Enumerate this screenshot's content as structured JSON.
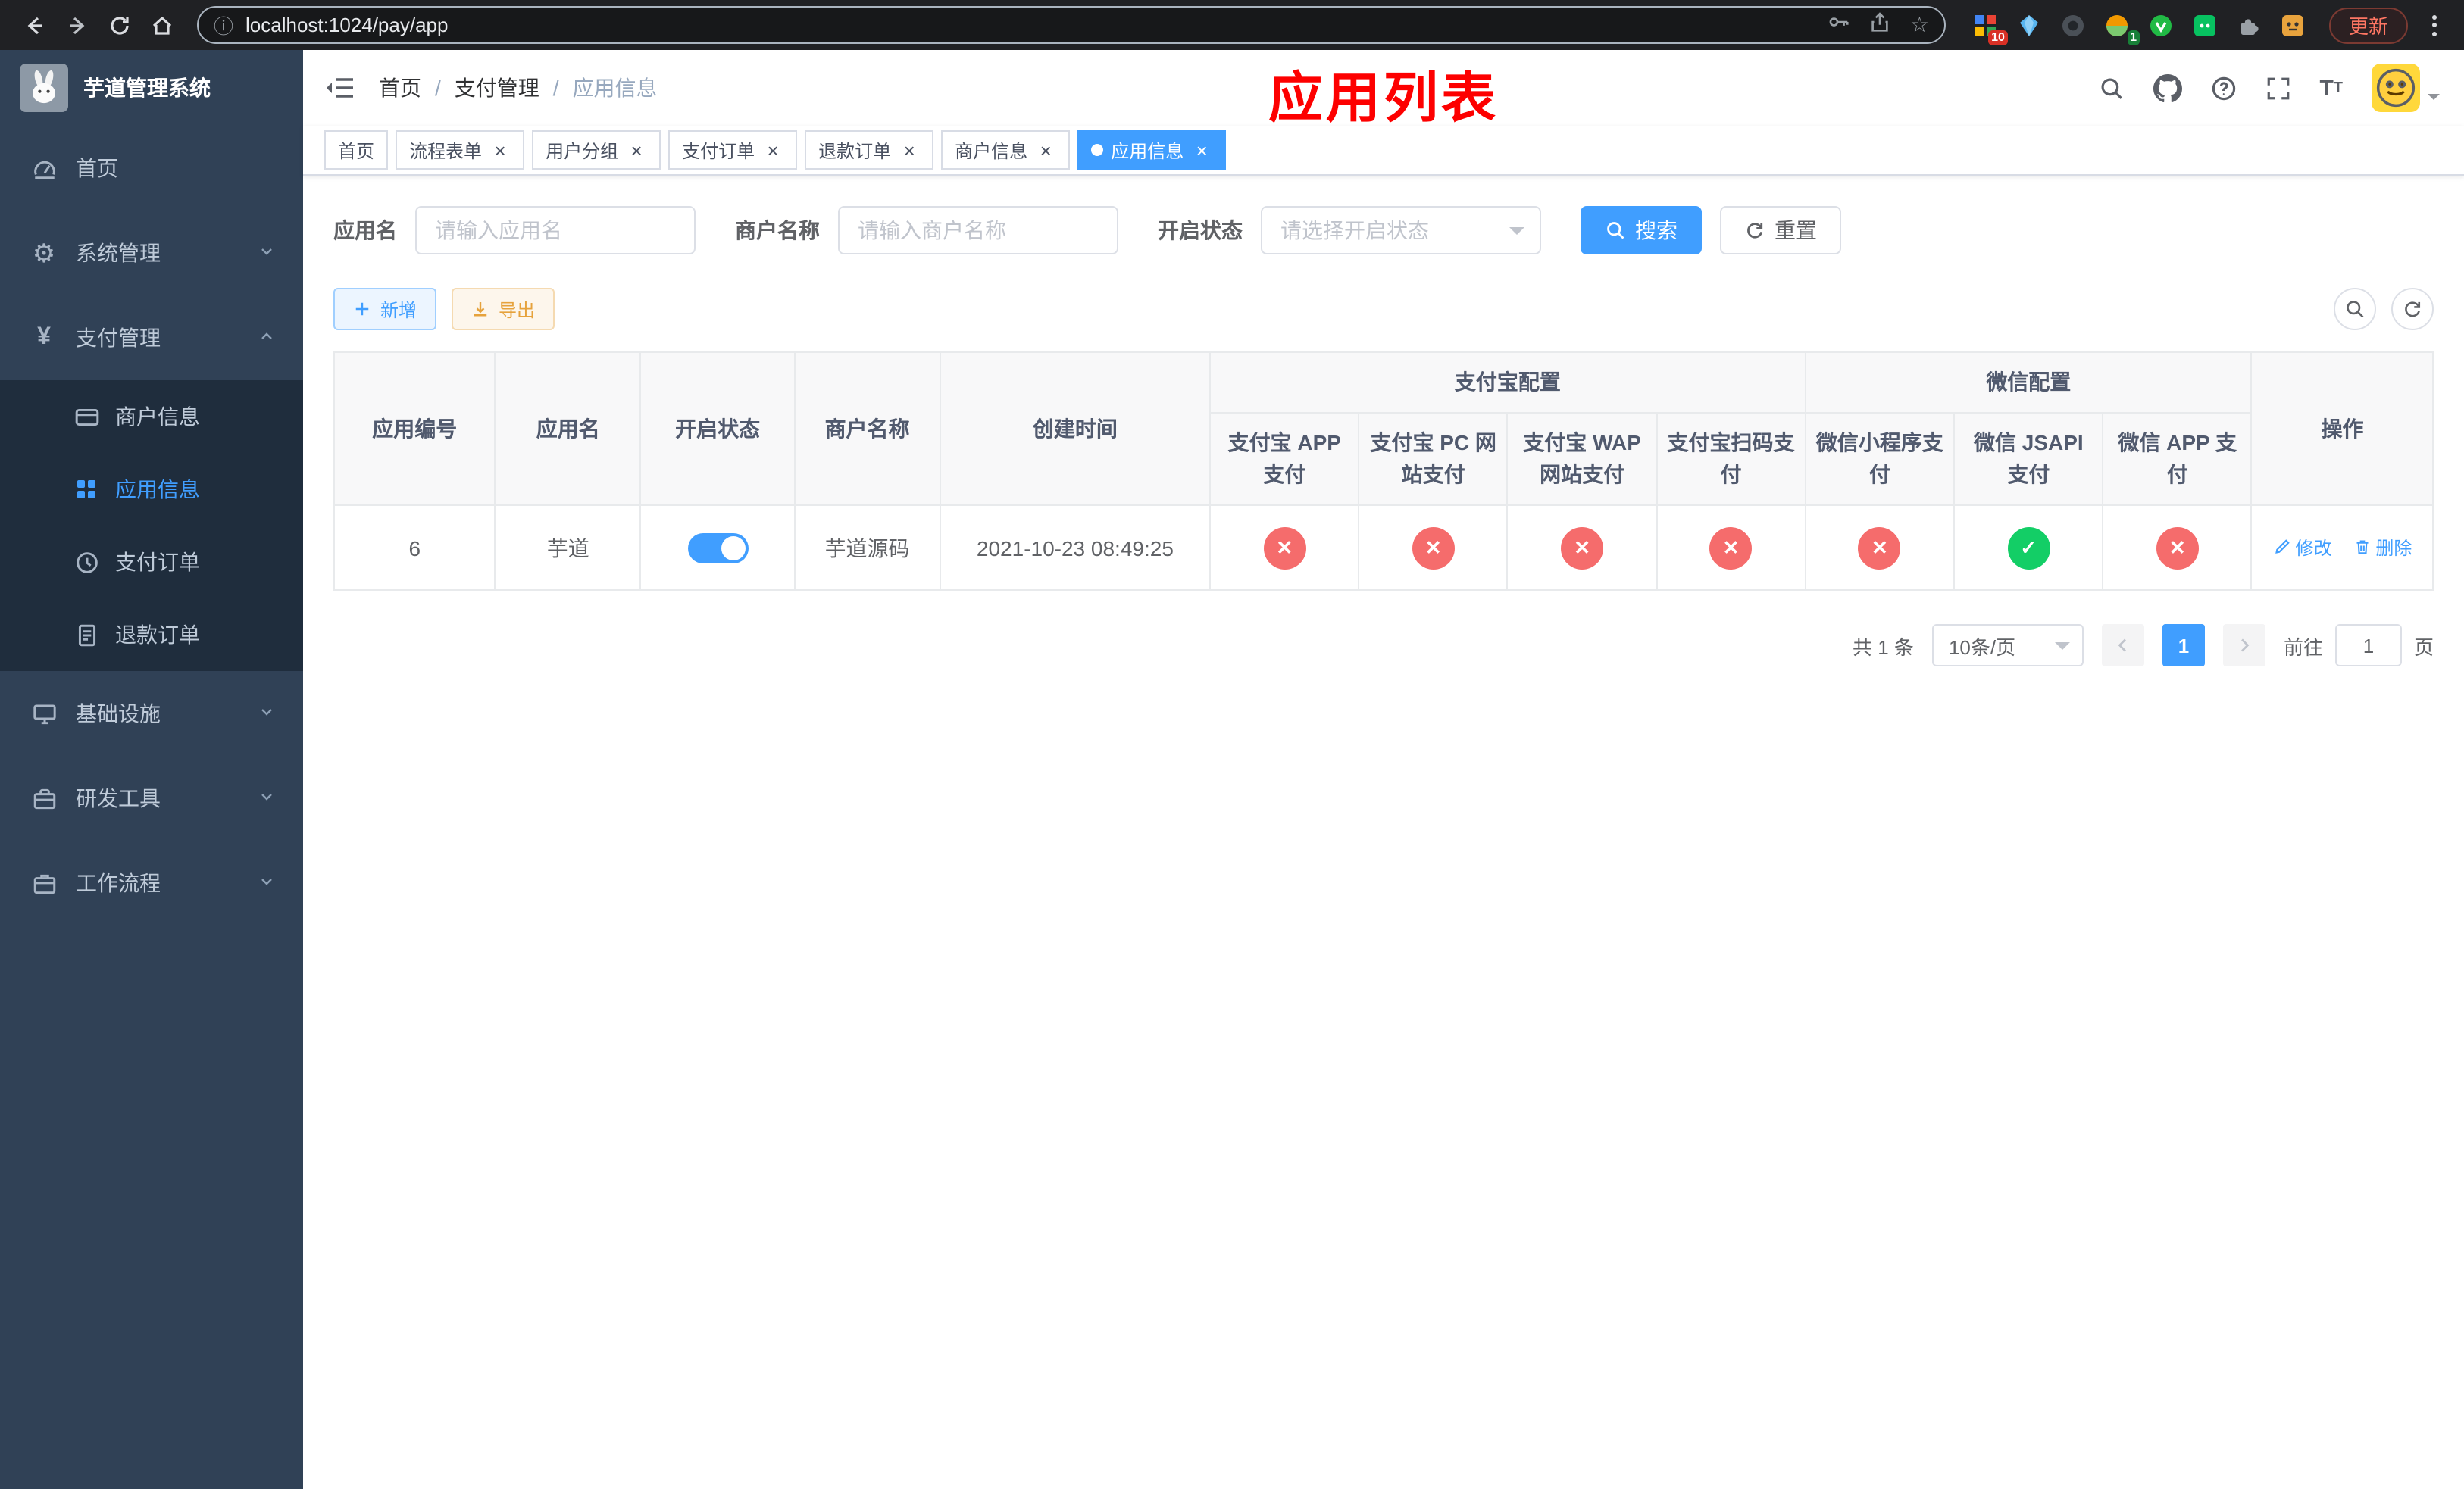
{
  "browser": {
    "url": "localhost:1024/pay/app",
    "update_label": "更新",
    "ext_badge_grid": "10",
    "ext_badge_avatar": "1"
  },
  "annotation": "应用列表",
  "sidebar": {
    "title": "芋道管理系统",
    "items": [
      {
        "label": "首页"
      },
      {
        "label": "系统管理"
      },
      {
        "label": "支付管理",
        "expanded": true,
        "children": [
          {
            "label": "商户信息",
            "active": false
          },
          {
            "label": "应用信息",
            "active": true
          },
          {
            "label": "支付订单",
            "active": false
          },
          {
            "label": "退款订单",
            "active": false
          }
        ]
      },
      {
        "label": "基础设施"
      },
      {
        "label": "研发工具"
      },
      {
        "label": "工作流程"
      }
    ]
  },
  "navbar": {
    "breadcrumb": [
      "首页",
      "支付管理",
      "应用信息"
    ]
  },
  "tabs": [
    {
      "label": "首页",
      "closable": false,
      "active": false
    },
    {
      "label": "流程表单",
      "closable": true,
      "active": false
    },
    {
      "label": "用户分组",
      "closable": true,
      "active": false
    },
    {
      "label": "支付订单",
      "closable": true,
      "active": false
    },
    {
      "label": "退款订单",
      "closable": true,
      "active": false
    },
    {
      "label": "商户信息",
      "closable": true,
      "active": false
    },
    {
      "label": "应用信息",
      "closable": true,
      "active": true
    }
  ],
  "filters": {
    "app_name_label": "应用名",
    "app_name_placeholder": "请输入应用名",
    "merchant_label": "商户名称",
    "merchant_placeholder": "请输入商户名称",
    "status_label": "开启状态",
    "status_placeholder": "请选择开启状态",
    "search_label": "搜索",
    "reset_label": "重置"
  },
  "toolbar": {
    "add_label": "新增",
    "export_label": "导出"
  },
  "table": {
    "group_alipay": "支付宝配置",
    "group_wechat": "微信配置",
    "col_id": "应用编号",
    "col_name": "应用名",
    "col_status": "开启状态",
    "col_merchant": "商户名称",
    "col_created": "创建时间",
    "col_alipay_app": "支付宝 APP 支付",
    "col_alipay_pc": "支付宝 PC 网站支付",
    "col_alipay_wap": "支付宝 WAP 网站支付",
    "col_alipay_qr": "支付宝扫码支付",
    "col_wx_lite": "微信小程序支付",
    "col_wx_jsapi": "微信 JSAPI 支付",
    "col_wx_app": "微信 APP 支付",
    "col_ops": "操作",
    "row": {
      "id": "6",
      "name": "芋道",
      "enabled": true,
      "merchant": "芋道源码",
      "created": "2021-10-23 08:49:25",
      "alipay_app": false,
      "alipay_pc": false,
      "alipay_wap": false,
      "alipay_qr": false,
      "wx_lite": false,
      "wx_jsapi": true,
      "wx_app": false,
      "edit_label": "修改",
      "delete_label": "删除"
    }
  },
  "pagination": {
    "total": "共 1 条",
    "page_size": "10条/页",
    "page": "1",
    "goto_label": "前往",
    "goto_value": "1",
    "goto_suffix": "页"
  },
  "colors": {
    "accent": "#409eff",
    "danger": "#f56c6c",
    "success": "#13ce66",
    "warning": "#e6a23c",
    "sidebar_bg": "#304156",
    "annotation": "#fd0000"
  }
}
